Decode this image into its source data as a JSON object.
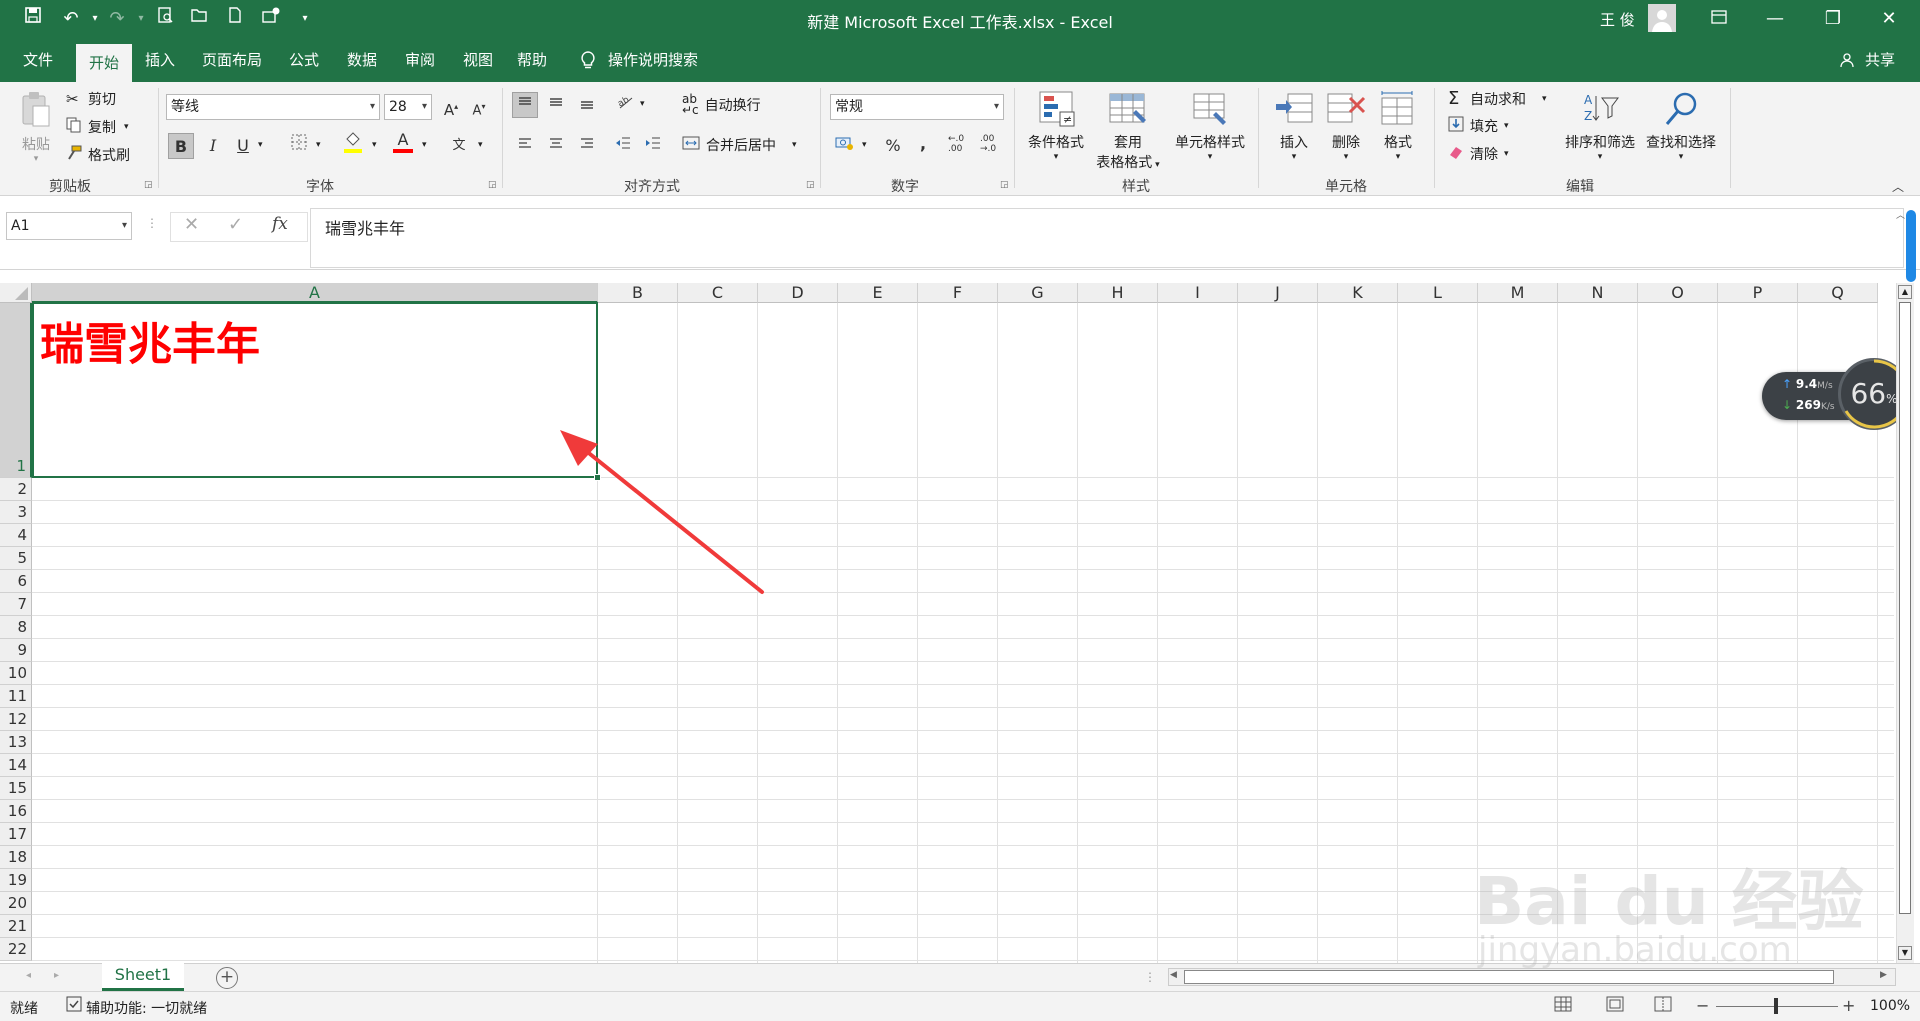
{
  "app": {
    "window_title": "新建 Microsoft Excel 工作表.xlsx  -  Excel",
    "user_name": "王 俊",
    "brand_color": "#217346"
  },
  "qat": {
    "icons": [
      "save-icon",
      "undo-icon",
      "redo-icon",
      "print-preview-icon",
      "open-icon",
      "new-icon",
      "touch-mode-icon",
      "customize-icon"
    ]
  },
  "tabs": [
    {
      "label": "文件"
    },
    {
      "label": "开始"
    },
    {
      "label": "插入"
    },
    {
      "label": "页面布局"
    },
    {
      "label": "公式"
    },
    {
      "label": "数据"
    },
    {
      "label": "审阅"
    },
    {
      "label": "视图"
    },
    {
      "label": "帮助"
    }
  ],
  "tell_me": "操作说明搜索",
  "share": "共享",
  "clipboard": {
    "group": "剪贴板",
    "paste": "粘贴",
    "cut": "剪切",
    "copy": "复制",
    "format_painter": "格式刷"
  },
  "font": {
    "group": "字体",
    "name": "等线",
    "size": "28",
    "grow": "A",
    "shrink": "A",
    "bold": "B",
    "italic": "I",
    "underline": "U",
    "color_a": "A",
    "phonetic": "文"
  },
  "alignment": {
    "group": "对齐方式",
    "wrap": "自动换行",
    "merge": "合并后居中"
  },
  "number": {
    "group": "数字",
    "format": "常规",
    "percent": "%",
    "comma": ",",
    "inc_dec": "←.0\n.00",
    "dec_dec": ".00\n→.0"
  },
  "styles": {
    "group": "样式",
    "conditional": "条件格式",
    "table_l1": "套用",
    "table_l2": "表格格式",
    "cell_styles": "单元格样式"
  },
  "cells": {
    "group": "单元格",
    "insert": "插入",
    "delete": "删除",
    "format": "格式"
  },
  "editing": {
    "group": "编辑",
    "autosum": "自动求和",
    "fill": "填充",
    "clear": "清除",
    "sort_filter": "排序和筛选",
    "find_select": "查找和选择"
  },
  "formula_bar": {
    "name_box": "A1",
    "fx": "fx",
    "content": "瑞雪兆丰年"
  },
  "columns": [
    "A",
    "B",
    "C",
    "D",
    "E",
    "F",
    "G",
    "H",
    "I",
    "J",
    "K",
    "L",
    "M",
    "N",
    "O",
    "P",
    "Q"
  ],
  "rows": [
    "1",
    "2",
    "3",
    "4",
    "5",
    "6",
    "7",
    "8",
    "9",
    "10",
    "11",
    "12",
    "13",
    "14",
    "15",
    "16",
    "17",
    "18",
    "19",
    "20",
    "21",
    "22"
  ],
  "cell_a1": {
    "value": "瑞雪兆丰年",
    "color": "#ff0000"
  },
  "net_widget": {
    "up": "9.4",
    "up_unit": "M/s",
    "down": "269",
    "down_unit": "K/s",
    "percent": "66",
    "percent_sign": "%"
  },
  "sheet": {
    "tab": "Sheet1"
  },
  "status": {
    "ready": "就绪",
    "accessibility": "辅助功能: 一切就绪",
    "zoom": "100%"
  },
  "watermark": {
    "logo": "Bai  du 经验",
    "url": "jingyan.baidu.com"
  }
}
